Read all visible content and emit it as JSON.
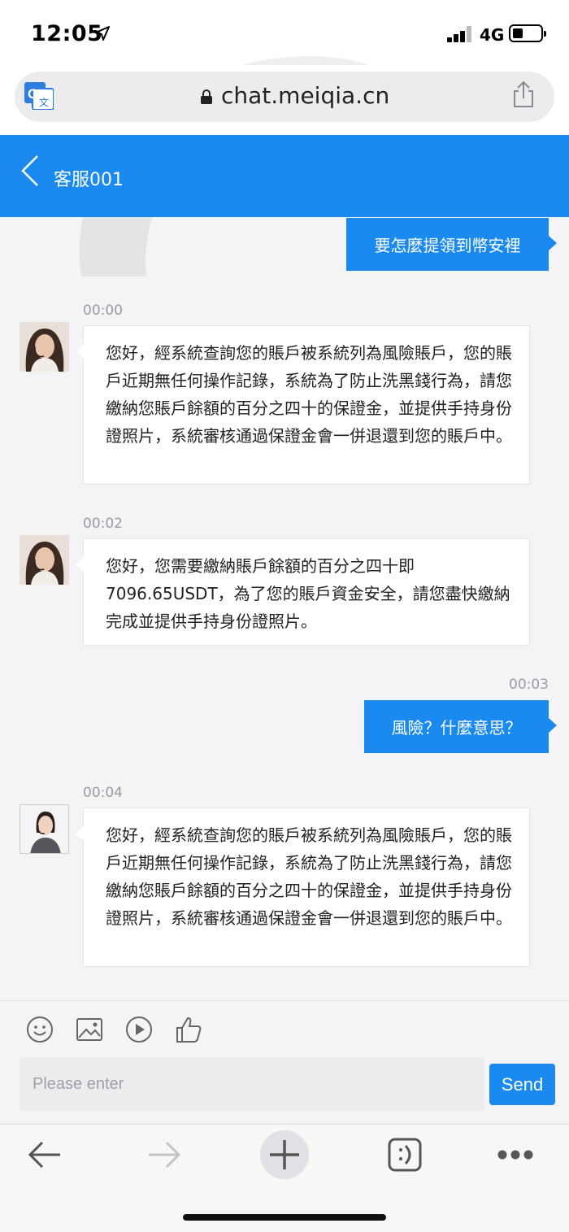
{
  "status_bar": {
    "time": "12:05",
    "network": "4G"
  },
  "browser": {
    "url": "chat.meiqia.cn"
  },
  "header": {
    "agent_name": "客服001"
  },
  "messages": [
    {
      "from": "me",
      "text": "要怎麼提領到幣安裡"
    },
    {
      "from": "agent",
      "time": "00:00",
      "text": "您好，經系統查詢您的賬戶被系統列為風險賬戶，您的賬戶近期無任何操作記錄，系統為了防止洗黑錢行為，請您繳納您賬戶餘額的百分之四十的保證金，並提供手持身份證照片，系統審核通過保證金會一併退還到您的賬戶中。"
    },
    {
      "from": "agent",
      "time": "00:02",
      "text": "您好，您需要繳納賬戶餘額的百分之四十即7096.65USDT，為了您的賬戶資金安全，請您盡快繳納完成並提供手持身份證照片。"
    },
    {
      "from": "me",
      "time": "00:03",
      "text": "風險？什麼意思？"
    },
    {
      "from": "agent",
      "time": "00:04",
      "text": "您好，經系統查詢您的賬戶被系統列為風險賬戶，您的賬戶近期無任何操作記錄，系統為了防止洗黑錢行為，請您繳納您賬戶餘額的百分之四十的保證金，並提供手持身份證照片，系統審核通過保證金會一併退還到您的賬戶中。"
    }
  ],
  "composer": {
    "placeholder": "Please enter",
    "send_label": "Send"
  },
  "toolbar_icons": [
    "emoji-icon",
    "image-icon",
    "video-icon",
    "thumbs-up-icon"
  ],
  "safari_icons": [
    "back-arrow-icon",
    "forward-arrow-icon",
    "new-tab-icon",
    "tabs-icon",
    "more-icon"
  ],
  "colors": {
    "accent": "#1a8af0",
    "background": "#f4f4f6"
  }
}
